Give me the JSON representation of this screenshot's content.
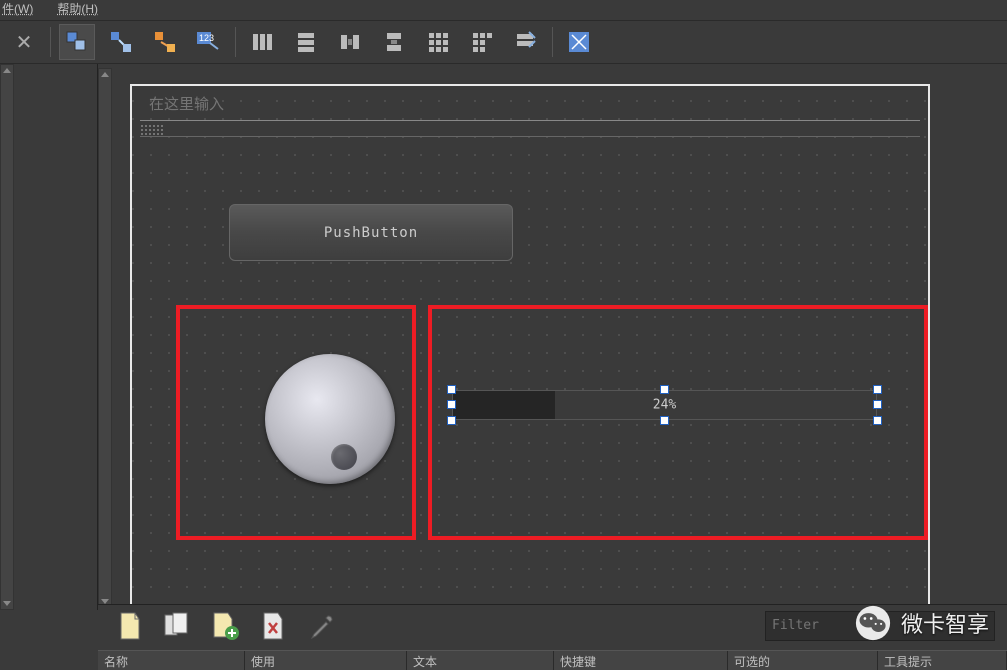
{
  "menubar": {
    "items": [
      "件(W)",
      "帮助(H)"
    ]
  },
  "canvas": {
    "title_placeholder": "在这里输入",
    "push_button_label": "PushButton",
    "progress_value": 24,
    "progress_text": "24%"
  },
  "filter": {
    "placeholder": "Filter"
  },
  "bottom_headers": [
    "名称",
    "使用",
    "文本",
    "快捷键",
    "可选的",
    "工具提示"
  ],
  "watermark": {
    "text": "微卡智享"
  }
}
